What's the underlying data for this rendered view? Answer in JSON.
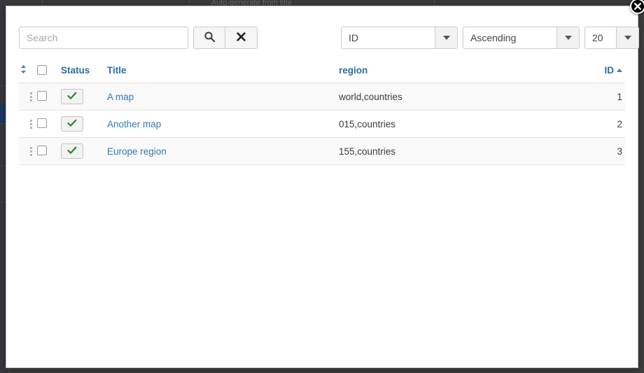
{
  "background": {
    "topbar_text": "Auto-generate from title"
  },
  "modal": {
    "close_label": "Close",
    "toolbar": {
      "search_placeholder": "Search",
      "search_value": "",
      "search_button_label": "Search",
      "clear_button_label": "Clear",
      "sort_field": {
        "value": "ID"
      },
      "sort_order": {
        "value": "Ascending"
      },
      "page_limit": {
        "value": "20"
      }
    },
    "table": {
      "headers": {
        "handle": "",
        "select_all": "",
        "status": "Status",
        "title": "Title",
        "region": "region",
        "id": "ID"
      },
      "sort_column": "ID",
      "sort_direction": "ascending",
      "rows": [
        {
          "status": "enabled",
          "title": "A map",
          "region": "world,countries",
          "id": "1"
        },
        {
          "status": "enabled",
          "title": "Another map",
          "region": "015,countries",
          "id": "2"
        },
        {
          "status": "enabled",
          "title": "Europe region",
          "region": "155,countries",
          "id": "3"
        }
      ]
    }
  },
  "colors": {
    "link": "#337ab7",
    "header_link": "#2b6ca3",
    "check_green": "#2e8b30",
    "row_stripe": "#f9f9f9"
  }
}
